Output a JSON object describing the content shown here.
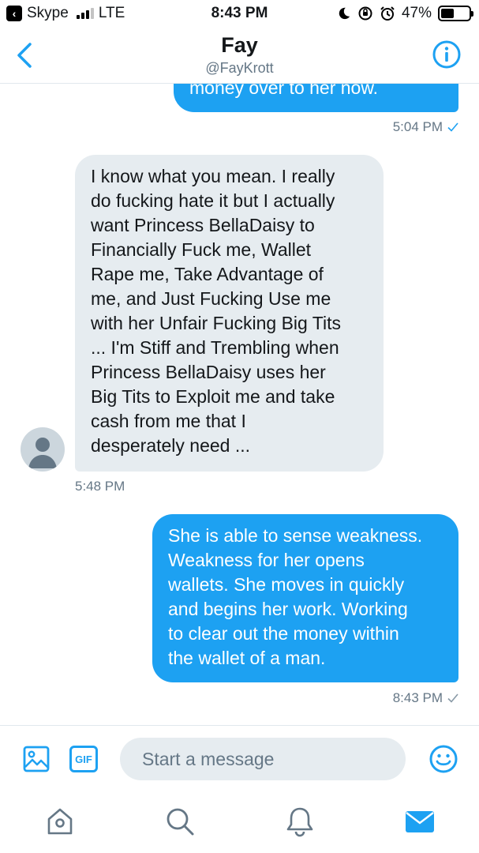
{
  "status_bar": {
    "back_app": "Skype",
    "carrier": "LTE",
    "time": "8:43 PM",
    "battery": "47%",
    "battery_level": 0.47
  },
  "header": {
    "title": "Fay",
    "handle": "@FayKrott"
  },
  "messages": [
    {
      "direction": "sent",
      "text": "money over to her now.",
      "time": "5:04 PM",
      "status": "sent"
    },
    {
      "direction": "received",
      "text": "I know what you mean. I  really\ndo fucking hate it but I actually\nwant Princess BellaDaisy to\nFinancially Fuck me, Wallet\nRape me, Take Advantage of\nme, and Just Fucking Use me\nwith her Unfair Fucking Big Tits\n... I'm Stiff and Trembling when\nPrincess BellaDaisy uses her\nBig Tits to Exploit me and take\ncash from me that I\ndesperately need ...",
      "time": "5:48 PM"
    },
    {
      "direction": "sent",
      "text": "She is able to sense weakness.\nWeakness for her opens\nwallets. She moves in quickly\nand begins her work. Working\nto clear out the money within\nthe wallet of a man.",
      "time": "8:43 PM",
      "status": "sent"
    }
  ],
  "composer": {
    "gif_label": "GIF",
    "placeholder": "Start a message"
  },
  "tabs": [
    "home-icon",
    "search-icon",
    "notifications-icon",
    "messages-icon"
  ],
  "colors": {
    "accent": "#1da1f2",
    "received_bubble": "#e6ecf0",
    "muted_text": "#657786"
  }
}
